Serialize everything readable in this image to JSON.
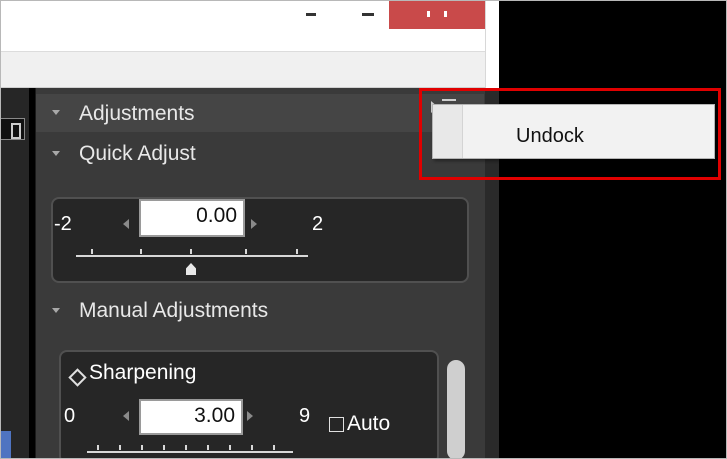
{
  "window": {
    "controls": [
      "minimize",
      "maximize",
      "close"
    ]
  },
  "panel": {
    "adjustments_title": "Adjustments",
    "quick_adjust": {
      "title": "Quick Adjust",
      "min": "-2",
      "max": "2",
      "value": "0.00",
      "slider_position": 0.5,
      "tick_count": 5
    },
    "manual_adjustments": {
      "title": "Manual Adjustments",
      "sharpening": {
        "label": "Sharpening",
        "min": "0",
        "max": "9",
        "value": "3.00",
        "auto_label": "Auto",
        "auto_checked": false,
        "slider_position": 0.33
      }
    }
  },
  "context_menu": {
    "items": [
      {
        "label": "Undock"
      }
    ],
    "highlight_color": "#e00000"
  },
  "colors": {
    "panel_bg": "#3a3a3a",
    "field_bg": "#262626",
    "close_button": "#c94a4a",
    "accent_blue": "#4f74c1"
  }
}
